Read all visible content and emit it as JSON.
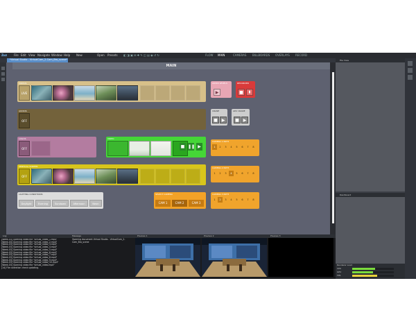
{
  "app": {
    "logo": "Zuz",
    "menu": [
      "File",
      "Edit",
      "View",
      "Navigate",
      "Window",
      "Help"
    ],
    "toolbar": [
      "New",
      "Open",
      "Presets"
    ],
    "modes": [
      "FLOW",
      "MAIN",
      "CAMERAS",
      "BILLBOARDS",
      "OVERLAYS",
      "RECORD"
    ],
    "active_mode": "MAIN",
    "doc_tab": "*Virtual Studio - VirtualCam_2-Cam_Bro_scene*"
  },
  "main": {
    "title": "MAIN",
    "panels": {
      "videos": {
        "title": "VIDEOS",
        "state": "LIVE"
      },
      "audios": {
        "title": "AUDIOS",
        "state": "OFF"
      },
      "logos": {
        "title": "LOGOS",
        "state": "OFF"
      },
      "video": {
        "title": "VIDEO"
      },
      "vertical_screen": {
        "title": "VERTICAL SCREEN",
        "state": "OFF"
      },
      "lighting": {
        "title": "LIGHTING CONDITIONS",
        "buttons": [
          "Daylight",
          "Evening",
          "Sundown",
          "Afternoon",
          "Neon"
        ]
      },
      "select_camera": {
        "title": "SELECT CAMERA",
        "buttons": [
          "CAM 1",
          "CAM 2",
          "CAM 3"
        ]
      },
      "audio_levels": {
        "title": "AUDIO LEVELS"
      },
      "recorder": {
        "title": "RECORDER"
      },
      "crane": {
        "title": "CRANE"
      },
      "adv_crane": {
        "title": "ADV CRANE"
      },
      "camera1_path": {
        "title": "CAMERA 1 PATH",
        "numbers": [
          "1",
          "2",
          "3",
          "4",
          "5",
          "6",
          "7",
          "8"
        ]
      },
      "camera2_path": {
        "title": "CAMERA 2 PATH",
        "numbers": [
          "1",
          "2",
          "3",
          "4",
          "5",
          "6",
          "7",
          "8"
        ]
      },
      "camera3_path": {
        "title": "CAMERA 3 PATH",
        "numbers": [
          "1",
          "2",
          "3",
          "4",
          "5",
          "6",
          "7",
          "8"
        ]
      }
    }
  },
  "right": {
    "file_view": "File View",
    "dashboard": "Dashboard",
    "levels_title": "Renderer Load",
    "levels": [
      {
        "label": "CPU",
        "value": 0.55
      },
      {
        "label": "GPU",
        "value": 0.5
      },
      {
        "label": "FPS",
        "value": 0.6
      }
    ]
  },
  "bottom": {
    "log_title": "Log",
    "log_lines": [
      "[Week-03] Opening video file \"virtual_video_1.mp4\"",
      "[Week-03] Opening video file \"virtual_video_2.mp4\"",
      "[Week-03] Opening video file \"virtual_video_3.mp4\"",
      "[Week-03] Opening video file \"virtual_video_4.mp4\"",
      "[Week-03] Opening video file \"virtual_video_5.mp4\"",
      "[Week-03] Opening video file \"virtual_video_6.mp4\"",
      "[Week-03] Opening video file \"virtual_video_7.mp4\"",
      "[Week-03] Opening video file \"virtual_video_8.mp4\"",
      "[Week-03] Opening video file \"virtual_video_9.mp4\"",
      "[Week-03] Opening video file \"virtual_video_10.mp4\"",
      "[Week-03] Opening video file \"virtual_video.mp4\"",
      "[14] File collection check updating."
    ],
    "message_title": "Message",
    "message_text": "Opening document Virtual Studio - VirtualCam_2-Cam_Bro_scene",
    "preview1": "Preview 1",
    "preview2": "Preview 2",
    "preview3": "Preview 3"
  }
}
